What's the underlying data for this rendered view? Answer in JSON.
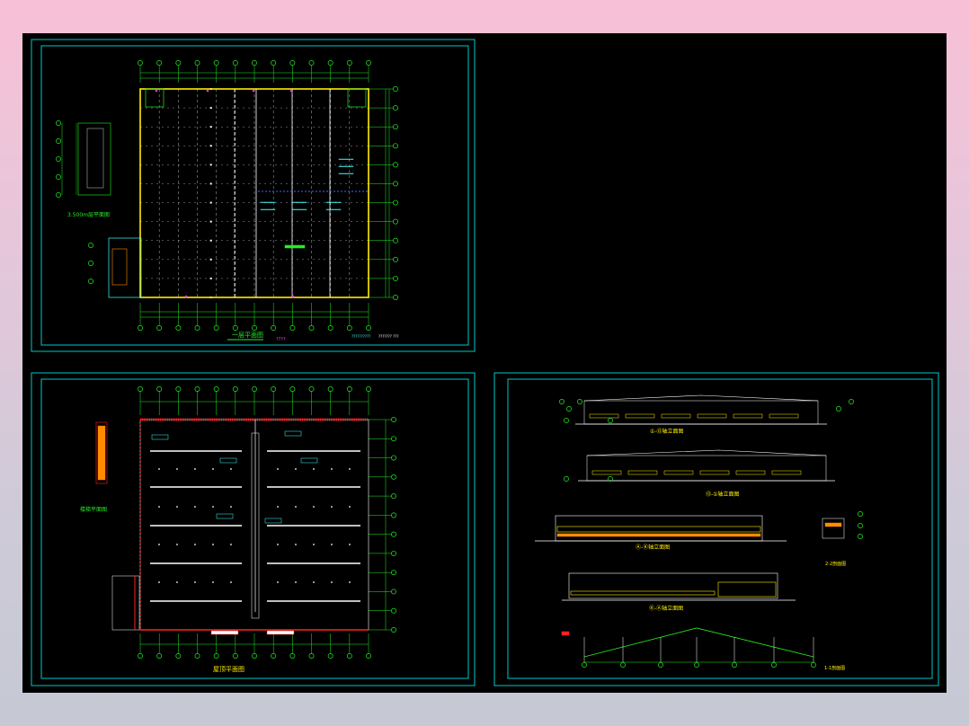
{
  "colors": {
    "background_gradient_top": "#f8c0d6",
    "background_gradient_bottom": "#c5c9d4",
    "canvas": "#000000",
    "frame": "#00c8c8",
    "axis_green": "#22ee22",
    "wall_yellow": "#ffee00",
    "grid_white": "#ffffff",
    "dim_green": "#22ee22",
    "accent_red": "#ff2222",
    "accent_orange": "#ff8c00",
    "accent_magenta": "#ff33ff",
    "text_cyan": "#3fffff"
  },
  "sheets": {
    "floor1": {
      "title": "一层平面图",
      "mezzanine_title": "3.500m层平面图",
      "area_tag": "????",
      "note_cyan": "??????????",
      "note_right": "??????? ???"
    },
    "roof": {
      "title": "屋顶平面图",
      "stair_title": "楼梯平面图"
    },
    "elevations": {
      "elev1_title": "①-⑬轴立面图",
      "elev2_title": "⑬-①轴立面图",
      "elev3_title": "Ⓐ-Ⓚ轴立面图",
      "elev4_title": "Ⓚ-Ⓐ轴立面图",
      "section_title": "1-1剖面图",
      "detail_title": "2-2剖面图"
    }
  }
}
